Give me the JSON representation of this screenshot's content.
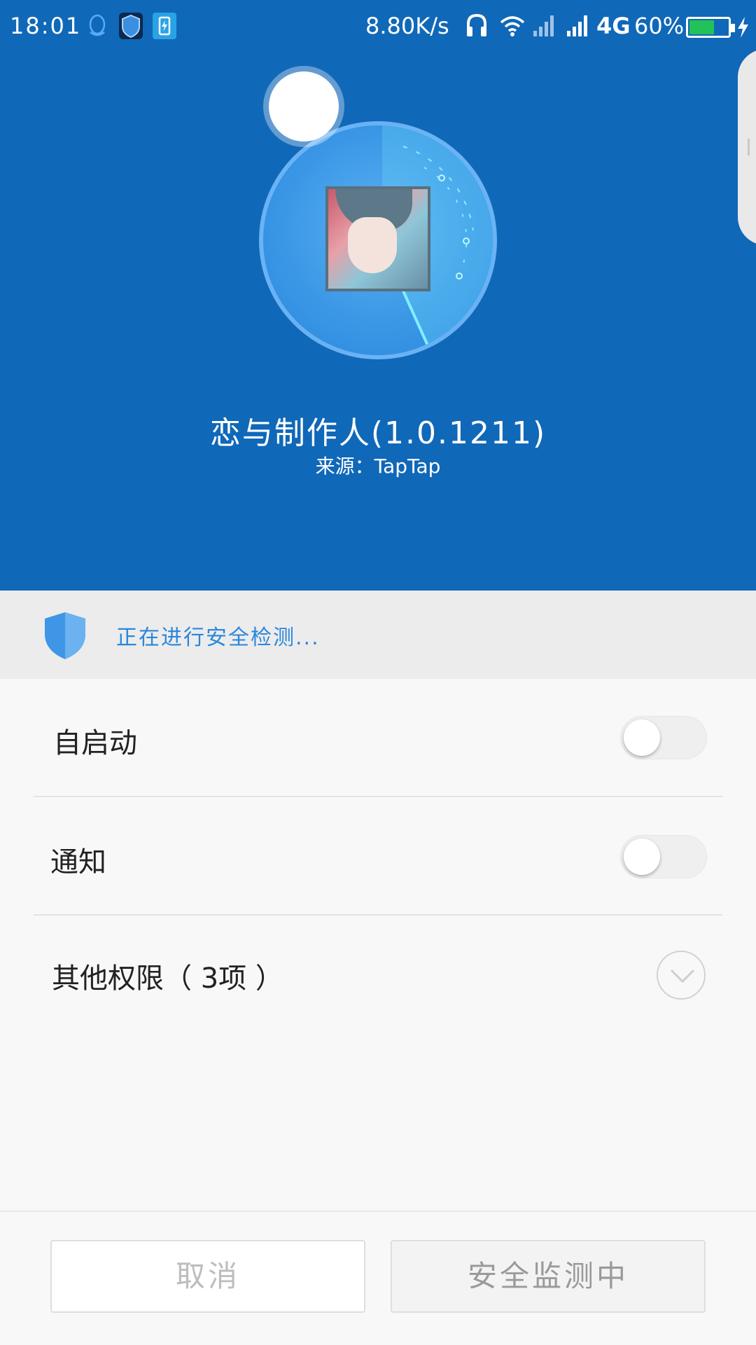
{
  "status_bar": {
    "time": "18:01",
    "net_speed": "8.80K/s",
    "network_type": "4G",
    "battery_percent": "60%",
    "battery_level": 0.6,
    "icons": [
      "qq-icon",
      "security-shield-icon",
      "battery-saver-icon",
      "headphones-icon",
      "wifi-icon",
      "signal-icon",
      "signal-icon",
      "charging-bolt-icon"
    ]
  },
  "app": {
    "title": "恋与制作人(1.0.1211)",
    "source": "来源：TapTap"
  },
  "security": {
    "status_text": "正在进行安全检测...",
    "color": "#2a86dc"
  },
  "permissions": {
    "autostart": {
      "label": "自启动",
      "enabled": false
    },
    "notification": {
      "label": "通知",
      "enabled": false
    },
    "other": {
      "label": "其他权限（ 3项 ）"
    }
  },
  "buttons": {
    "cancel": "取消",
    "monitoring": "安全监测中"
  },
  "colors": {
    "hero_blue": "#1068b8",
    "accent_blue": "#2a86dc",
    "battery_green": "#22c25a"
  }
}
